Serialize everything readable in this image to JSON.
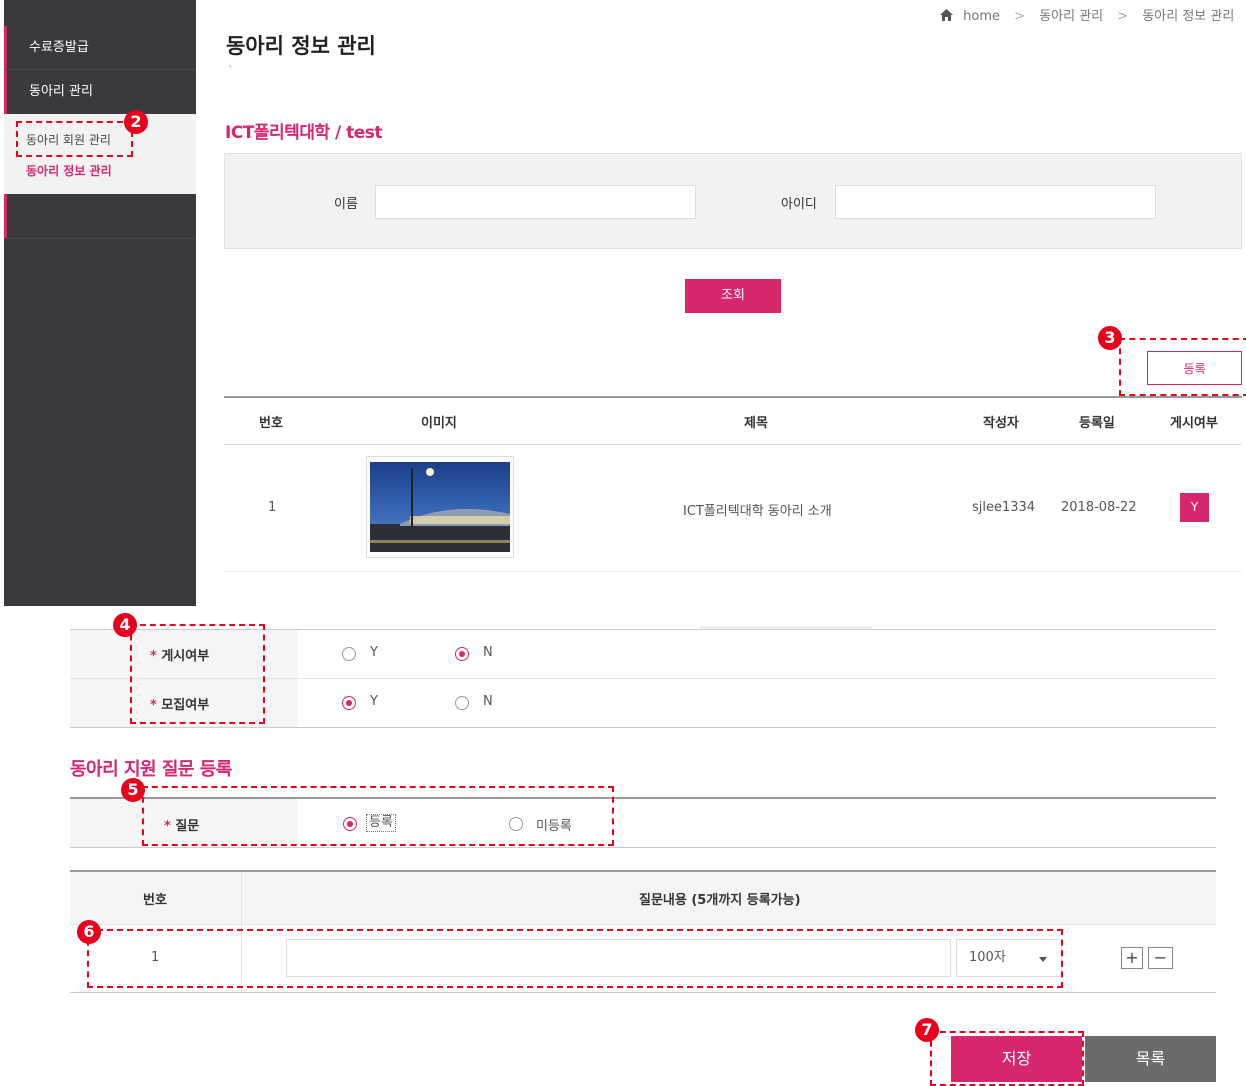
{
  "sidebar": {
    "items": [
      {
        "label": "수료증발급"
      },
      {
        "label": "동아리 관리"
      }
    ],
    "sub_items": [
      {
        "label": "동아리 회원 관리"
      },
      {
        "label": "동아리 정보 관리"
      }
    ]
  },
  "breadcrumb": {
    "home": "home",
    "sep": ">",
    "level1": "동아리 관리",
    "level2": "동아리 정보 관리"
  },
  "page_title": "동아리 정보 관리",
  "title_mark": "`",
  "club_heading": "ICT폴리텍대학 / test",
  "search": {
    "name_label": "이름",
    "id_label": "아이디",
    "search_button": "조회"
  },
  "register_button": "등록",
  "table": {
    "headers": [
      "번호",
      "이미지",
      "제목",
      "작성자",
      "등록일",
      "게시여부"
    ],
    "rows": [
      {
        "no": "1",
        "title": "ICT폴리텍대학 동아리 소개",
        "author": "sjlee1334",
        "date": "2018-08-22",
        "posted": "Y"
      }
    ]
  },
  "form": {
    "rows": [
      {
        "required": "*",
        "label": "게시여부",
        "options": [
          "Y",
          "N"
        ],
        "selected": "N"
      },
      {
        "required": "*",
        "label": "모집여부",
        "options": [
          "Y",
          "N"
        ],
        "selected": "Y"
      }
    ]
  },
  "question_section": {
    "heading": "동아리 지원 질문 등록",
    "required": "*",
    "label": "질문",
    "options": [
      "등록",
      "미등록"
    ],
    "selected": "등록"
  },
  "question_table": {
    "headers": [
      "번호",
      "질문내용 (5개까지 등록가능)"
    ],
    "rows": [
      {
        "no": "1",
        "content": "",
        "limit": "100자"
      }
    ],
    "add": "+",
    "remove": "−"
  },
  "actions": {
    "save": "저장",
    "list": "목록"
  },
  "callouts": [
    "2",
    "3",
    "4",
    "5",
    "6",
    "7"
  ],
  "colors": {
    "accent": "#d6266e",
    "sidebar": "#3a3a3e",
    "callout": "#e8001c",
    "list_button": "#6b6b6b"
  },
  "icons": {
    "home": "home-icon",
    "dropdown": "caret-down-icon"
  }
}
